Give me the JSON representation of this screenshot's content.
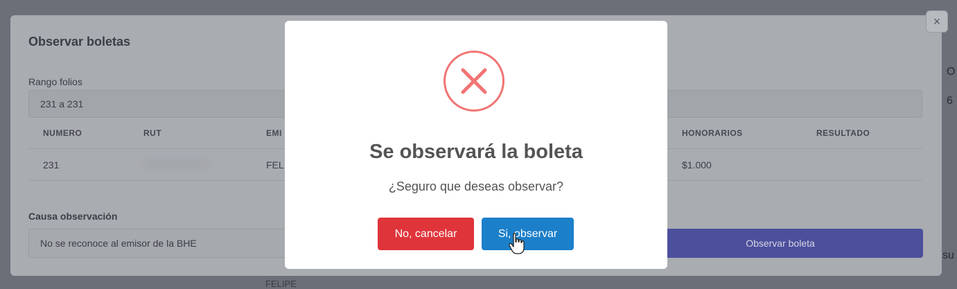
{
  "background": {
    "right_chars": [
      "O",
      "6",
      "su"
    ],
    "below_text": "FELIPE"
  },
  "modal": {
    "title": "Observar boletas",
    "rango_label": "Rango folios",
    "rango_value": "231 a 231",
    "table": {
      "headers": [
        "NUMERO",
        "RUT",
        "EMI",
        "HONORARIOS",
        "RESULTADO"
      ],
      "row": {
        "numero": "231",
        "emisor": "FEL",
        "honorarios": "$1.000"
      }
    },
    "causa_label": "Causa observación",
    "causa_value": "No se reconoce al emisor de la BHE",
    "submit_label": "Observar boleta",
    "close_label": "×"
  },
  "dialog": {
    "icon": "error-x-icon",
    "title": "Se observará la boleta",
    "text": "¿Seguro que deseas observar?",
    "cancel_label": "No, cancelar",
    "confirm_label": "Si, observar",
    "colors": {
      "cancel": "#e0343b",
      "confirm": "#1c7fc9",
      "icon": "#f27474"
    }
  }
}
